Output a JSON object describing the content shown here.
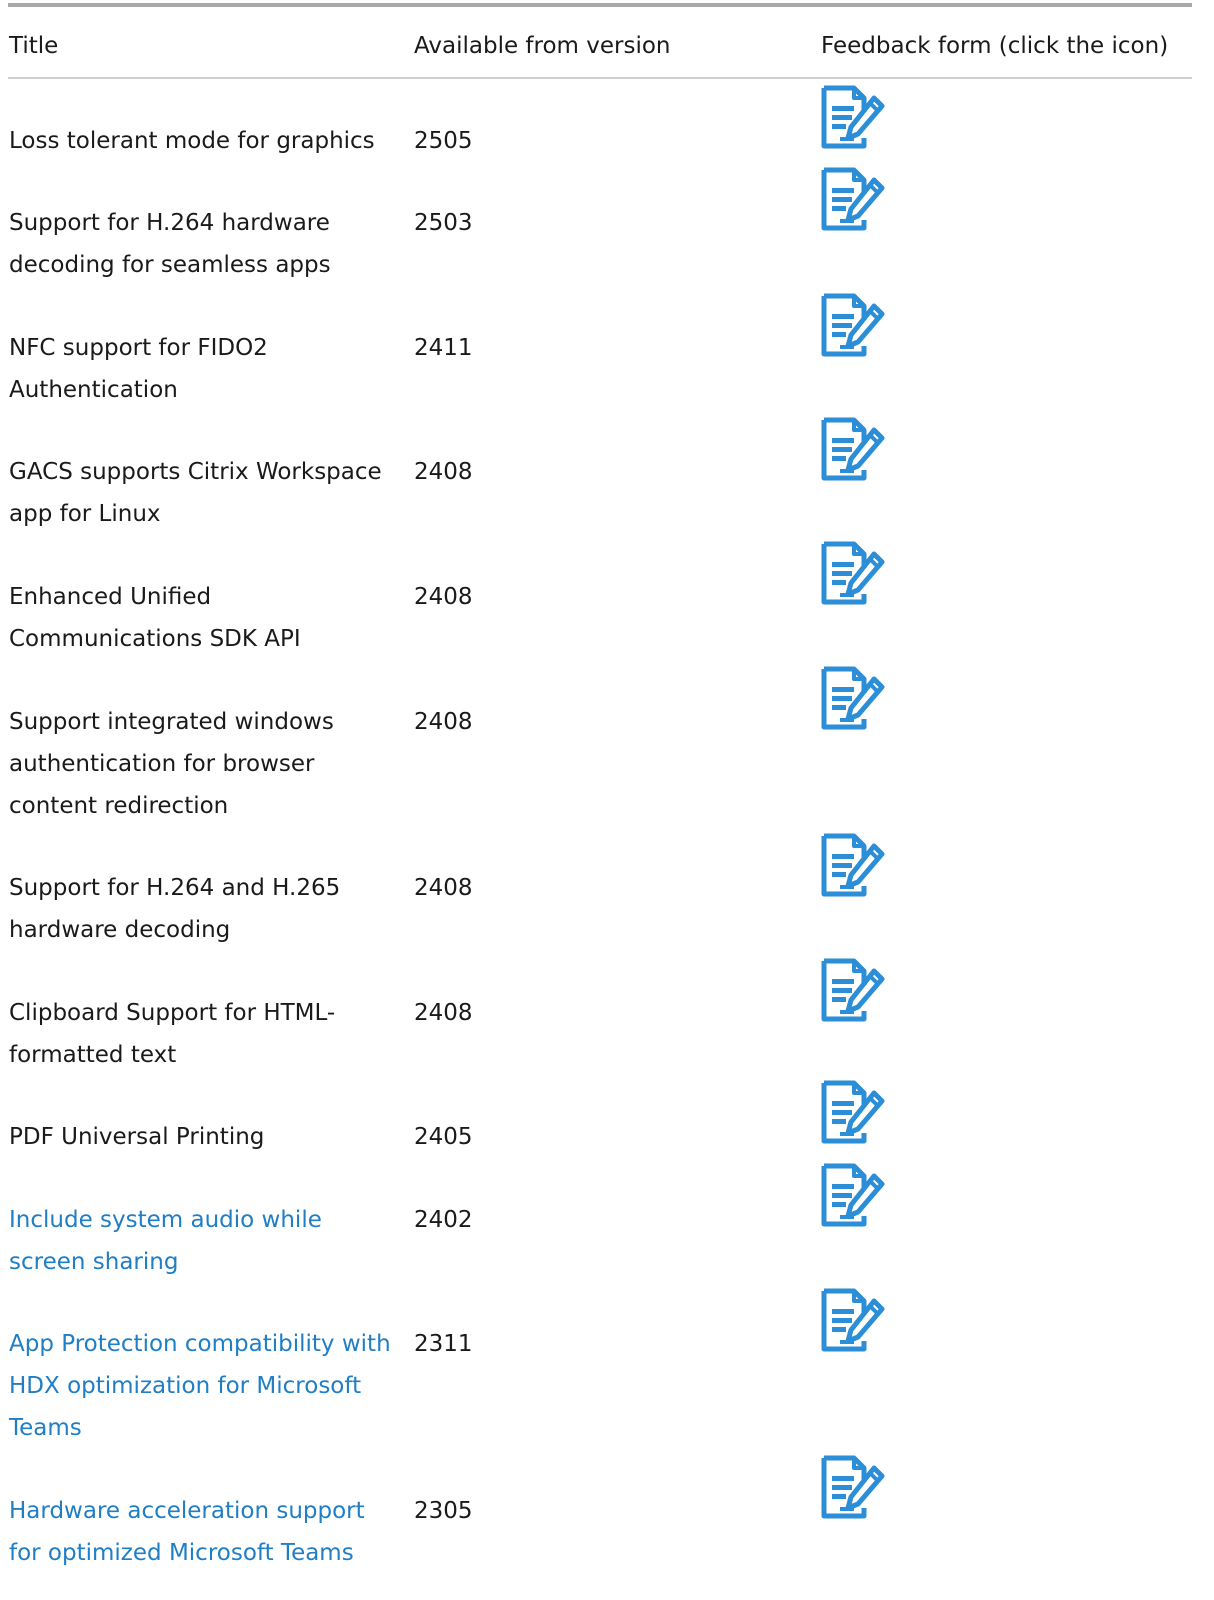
{
  "table": {
    "headers": {
      "title": "Title",
      "version": "Available from version",
      "feedback": "Feedback form (click the icon)"
    },
    "rows": [
      {
        "title": "Loss tolerant mode for graphics",
        "version": "2505",
        "is_link": false,
        "icon": "feedback-form-icon"
      },
      {
        "title": "Support for H.264 hardware decoding for seamless apps",
        "version": "2503",
        "is_link": false,
        "icon": "feedback-form-icon"
      },
      {
        "title": "NFC support for FIDO2 Authentication",
        "version": "2411",
        "is_link": false,
        "icon": "feedback-form-icon"
      },
      {
        "title": "GACS supports Citrix Workspace app for Linux",
        "version": "2408",
        "is_link": false,
        "icon": "feedback-form-icon"
      },
      {
        "title": "Enhanced Unified Communications SDK API",
        "version": "2408",
        "is_link": false,
        "icon": "feedback-form-icon"
      },
      {
        "title": "Support integrated windows authentication for browser content redirection",
        "version": "2408",
        "is_link": false,
        "icon": "feedback-form-icon"
      },
      {
        "title": "Support for H.264 and H.265 hardware decoding",
        "version": "2408",
        "is_link": false,
        "icon": "feedback-form-icon"
      },
      {
        "title": "Clipboard Support for HTML-formatted text",
        "version": "2408",
        "is_link": false,
        "icon": "feedback-form-icon"
      },
      {
        "title": "PDF Universal Printing",
        "version": "2405",
        "is_link": false,
        "icon": "feedback-form-icon"
      },
      {
        "title": "Include system audio while screen sharing",
        "version": "2402",
        "is_link": true,
        "icon": "feedback-form-icon"
      },
      {
        "title": "App Protection compatibility with HDX optimization for Microsoft Teams",
        "version": "2311",
        "is_link": true,
        "icon": "feedback-form-icon"
      },
      {
        "title": "Hardware acceleration support for optimized Microsoft Teams",
        "version": "2305",
        "is_link": true,
        "icon": "feedback-form-icon"
      }
    ]
  },
  "colors": {
    "link": "#1f7ec5",
    "icon": "#2b8ed6",
    "text": "#1a1a1a",
    "rule": "#a9a9a9"
  }
}
